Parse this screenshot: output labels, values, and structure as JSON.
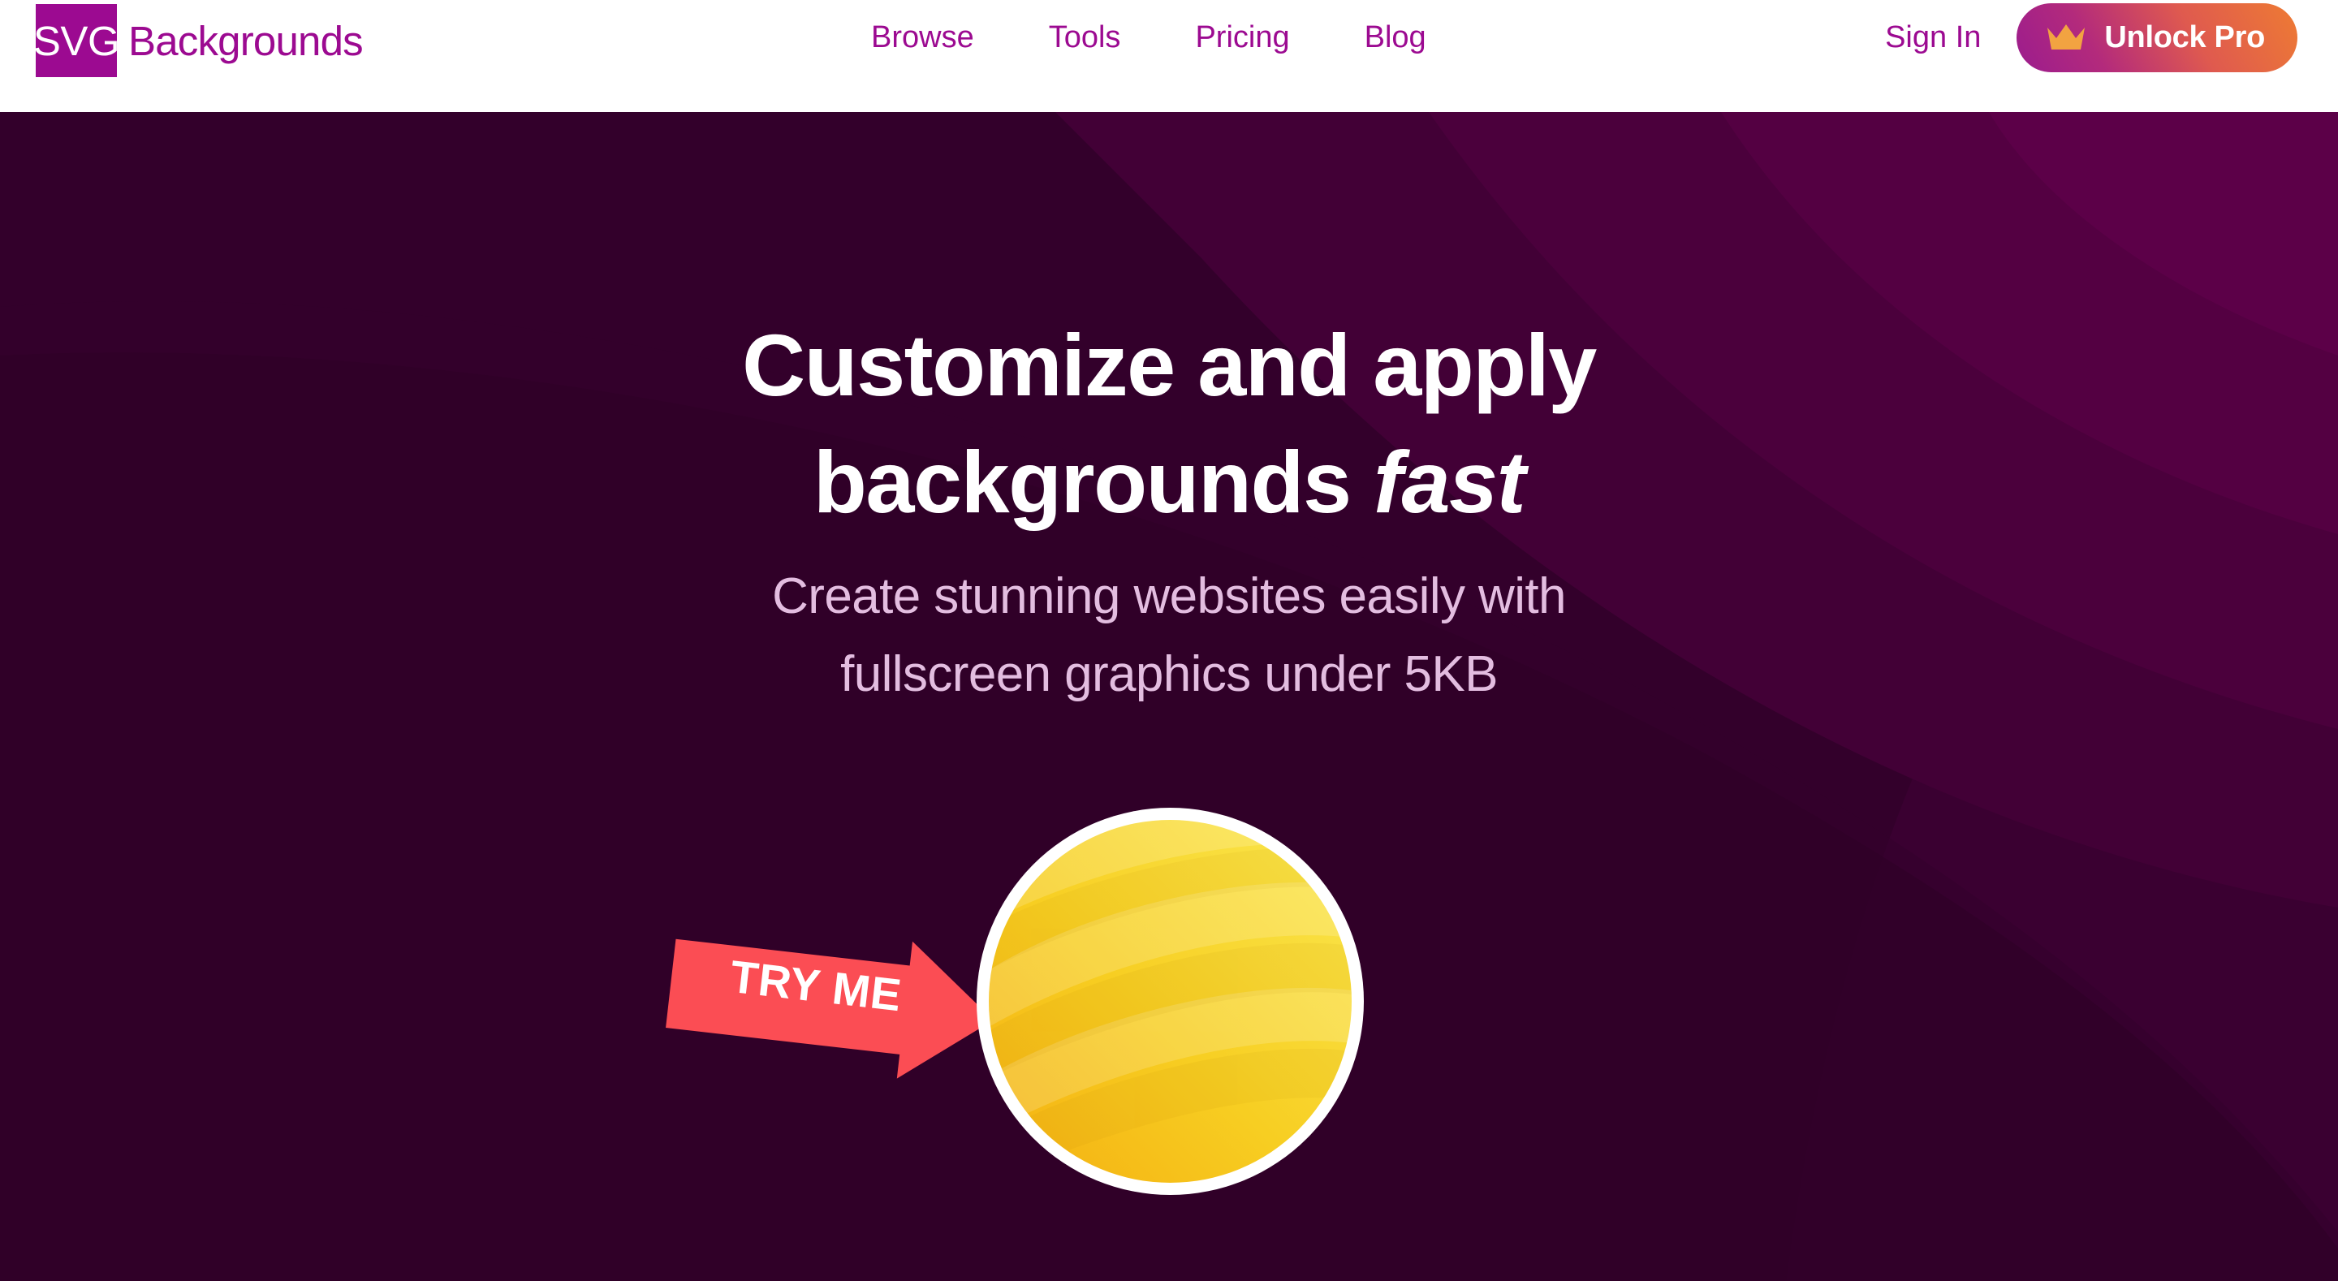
{
  "header": {
    "brand": {
      "mark_text": "SVG",
      "word_text": "Backgrounds",
      "mark_bg": "#9C0A91",
      "word_color": "#9C0A91"
    },
    "nav": [
      {
        "label": "Browse"
      },
      {
        "label": "Tools"
      },
      {
        "label": "Pricing"
      },
      {
        "label": "Blog"
      }
    ],
    "sign_in_label": "Sign In",
    "pro_button": {
      "label": "Unlock Pro",
      "icon": "crown-icon",
      "icon_color": "#F2A341",
      "gradient_from": "#9B1C8E",
      "gradient_to": "#EE7B33"
    }
  },
  "hero": {
    "title_line1": "Customize and apply",
    "title_line2_plain": "backgrounds ",
    "title_line2_em": "fast",
    "subtitle_line1": "Create stunning websites easily with",
    "subtitle_line2": "fullscreen graphics under 5KB",
    "title_color": "#FFFFFF",
    "subtitle_color": "#E3BDE0",
    "background_color": "#33002B",
    "background_band_color": "#3D0033"
  },
  "demo": {
    "try_me_label": "TRY ME",
    "try_me_color": "#FB4D54",
    "circle_ring_color": "#FFFFFF",
    "circle_color_light": "#F9E34A",
    "circle_color_dark": "#F5B911"
  }
}
